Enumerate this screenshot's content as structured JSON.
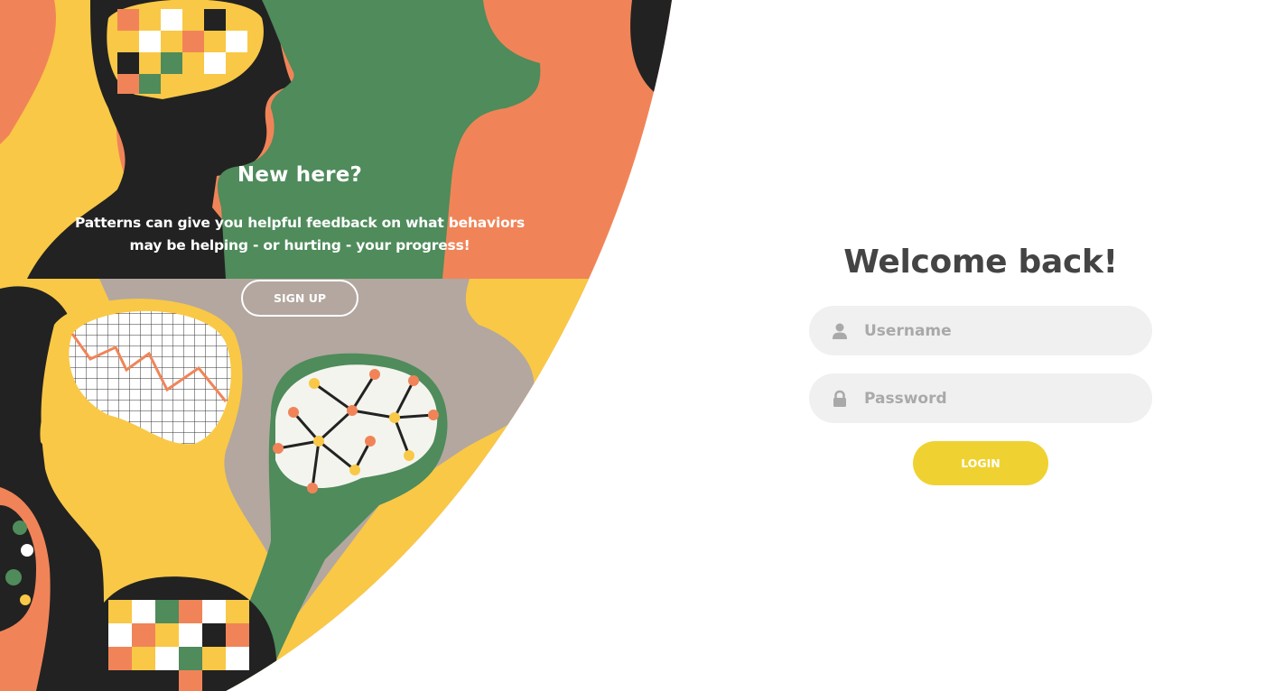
{
  "promo": {
    "title": "New here?",
    "text": "Patterns can give you helpful feedback on what behaviors may be helping - or hurting - your progress!",
    "signup_label": "SIGN UP"
  },
  "login": {
    "title": "Welcome back!",
    "username_placeholder": "Username",
    "password_placeholder": "Password",
    "login_label": "LOGIN",
    "username_icon": "user-icon",
    "password_icon": "lock-icon"
  },
  "colors": {
    "accent_yellow": "#efd231",
    "orange": "#f08458",
    "green": "#4f8b5b",
    "yellow": "#f9c846",
    "black": "#222222",
    "taupe": "#b3a79f",
    "input_bg": "#f0f0f0",
    "title_text": "#444444"
  }
}
